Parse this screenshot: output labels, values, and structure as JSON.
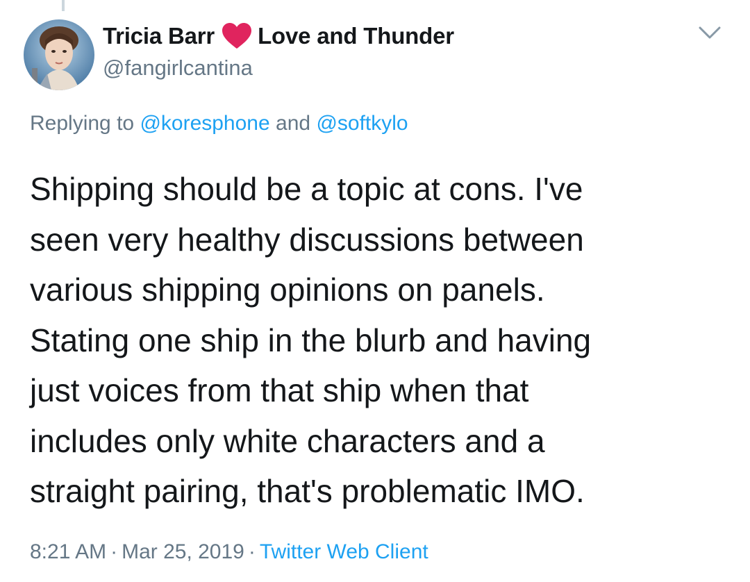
{
  "tweet": {
    "author": {
      "display_name_part1": "Tricia Barr",
      "emoji_icon": "red-heart-icon",
      "display_name_part2": "Love and Thunder",
      "handle": "@fangirlcantina"
    },
    "replying": {
      "prefix": "Replying to",
      "user1": "@koresphone",
      "conjunction": "and",
      "user2": "@softkylo"
    },
    "text_lines": [
      "Shipping should be a topic at cons. I've",
      "seen very healthy discussions between",
      "various shipping opinions on panels.",
      "Stating one ship in the blurb and having",
      "just voices from that ship when that",
      "includes only white characters and a",
      "straight pairing, that's problematic IMO."
    ],
    "time": "8:21 AM",
    "separator": "·",
    "date": "Mar 25, 2019",
    "source": "Twitter Web Client"
  },
  "colors": {
    "text_primary": "#14171a",
    "text_secondary": "#657786",
    "link": "#1da1f2",
    "heart": "#e0245e",
    "thread_line": "#ccd6dd"
  }
}
